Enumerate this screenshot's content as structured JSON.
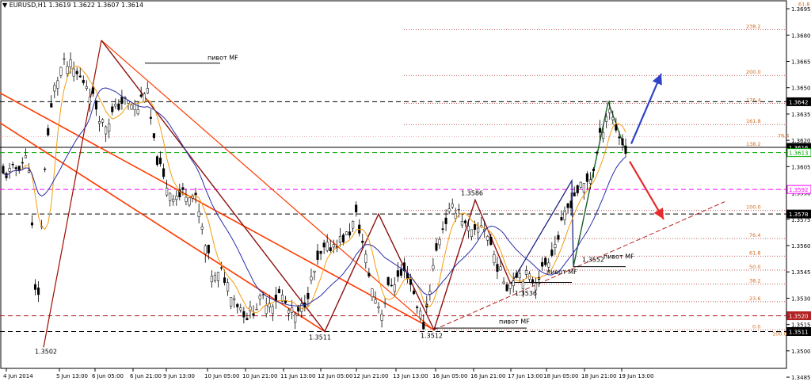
{
  "header": {
    "symbol_label": "EURUSD,H1",
    "ohlc_text": "1.3619 1.3622 1.3607 1.3614",
    "dropdown_glyph": "▼"
  },
  "colors": {
    "background": "#ffffff",
    "axis": "#000000",
    "candles": "#000000",
    "ma_fast": "#f39c12",
    "ma_slow": "#2b2fa8",
    "zigzag_dark": "#8b1010",
    "trend_orange": "#ff3b00",
    "fib_red": "#b22222",
    "fib_text": "#d2691e",
    "magenta": "#ff00ff",
    "green": "#00aa00",
    "arrow_blue": "#2f43c9",
    "arrow_red": "#e52b2b"
  },
  "chart_data": {
    "type": "candlestick",
    "symbol": "EURUSD",
    "timeframe": "H1",
    "ylim": [
      1.349,
      1.37
    ],
    "y_ticks": [
      "1.3695",
      "1.3680",
      "1.3665",
      "1.3650",
      "1.3635",
      "1.3620",
      "1.3605",
      "1.3590",
      "1.3575",
      "1.3560",
      "1.3545",
      "1.3530",
      "1.3515",
      "1.3500",
      "1.3485"
    ],
    "x_ticks": [
      "4 Jun 2014",
      "5 Jun 13:00",
      "6 Jun 05:00",
      "6 Jun 21:00",
      "9 Jun 13:00",
      "10 Jun 05:00",
      "10 Jun 21:00",
      "11 Jun 13:00",
      "12 Jun 05:00",
      "12 Jun 21:00",
      "13 Jun 13:00",
      "16 Jun 05:00",
      "16 Jun 21:00",
      "17 Jun 13:00",
      "18 Jun 05:00",
      "18 Jun 21:00",
      "19 Jun 13:00"
    ],
    "price_close_path": [
      1.36,
      1.3602,
      1.3606,
      1.3611,
      1.3515,
      1.361,
      1.3648,
      1.3663,
      1.3662,
      1.3656,
      1.3652,
      1.364,
      1.3628,
      1.3635,
      1.3642,
      1.3641,
      1.3638,
      1.3652,
      1.3615,
      1.3598,
      1.359,
      1.3588,
      1.3592,
      1.3585,
      1.356,
      1.354,
      1.3545,
      1.3535,
      1.3526,
      1.352,
      1.3525,
      1.353,
      1.3528,
      1.3533,
      1.3522,
      1.3519,
      1.353,
      1.3545,
      1.3556,
      1.356,
      1.3563,
      1.3566,
      1.3577,
      1.3555,
      1.3532,
      1.3523,
      1.3538,
      1.3542,
      1.3545,
      1.353,
      1.3514,
      1.3545,
      1.3568,
      1.3578,
      1.3583,
      1.357,
      1.3565,
      1.3574,
      1.356,
      1.3545,
      1.3537,
      1.3545,
      1.3543,
      1.354,
      1.3545,
      1.3555,
      1.3565,
      1.358,
      1.359,
      1.3594,
      1.36,
      1.3622,
      1.364,
      1.3625,
      1.3614
    ],
    "levels": [
      {
        "value": 1.3642,
        "label": "1.3642",
        "style": "dashed",
        "color": "#000000"
      },
      {
        "value": 1.3616,
        "label": "1.3616",
        "style": "solid",
        "color": "#000000"
      },
      {
        "value": 1.3613,
        "label": "1.3613",
        "style": "dashed",
        "color": "#00aa00"
      },
      {
        "value": 1.3592,
        "label": "1.3592",
        "style": "dashed",
        "color": "#ff00ff"
      },
      {
        "value": 1.3578,
        "label": "1.3578",
        "style": "dashed",
        "color": "#000000"
      },
      {
        "value": 1.352,
        "label": "1.3520",
        "style": "dashed",
        "color": "#b22222"
      },
      {
        "value": 1.3511,
        "label": "1.3511",
        "style": "dashed",
        "color": "#000000"
      }
    ],
    "fib_levels": [
      {
        "label": "0.0",
        "value": 1.3512
      },
      {
        "label": "23.6",
        "value": 1.3528
      },
      {
        "label": "38.2",
        "value": 1.3538
      },
      {
        "label": "50.0",
        "value": 1.3546
      },
      {
        "label": "61.8",
        "value": 1.3554
      },
      {
        "label": "76.4",
        "value": 1.3564
      },
      {
        "label": "100.0",
        "value": 1.358
      },
      {
        "label": "138.2",
        "value": 1.3616
      },
      {
        "label": "161.8",
        "value": 1.3629
      },
      {
        "label": "176.4",
        "value": 1.3641
      },
      {
        "label": "200.0",
        "value": 1.3657
      },
      {
        "label": "238.2",
        "value": 1.3683
      }
    ],
    "fib_extra_labels": [
      {
        "label": "61.8",
        "value": 1.3698
      },
      {
        "label": "76.4",
        "value": 1.3623
      },
      {
        "label": "100.0",
        "value": 1.351
      }
    ],
    "annotations": [
      {
        "text": "1.3502",
        "x": "5 Jun 13:00",
        "y": 1.3502
      },
      {
        "text": "1.3511",
        "x": "12 Jun 05:00",
        "y": 1.3511
      },
      {
        "text": "1.3512",
        "x": "16 Jun 05:00",
        "y": 1.3512
      },
      {
        "text": "1.3586",
        "x": "16 Jun 21:00",
        "y": 1.3586
      },
      {
        "text": "1.3536",
        "x": "17 Jun 13:00",
        "y": 1.3536
      },
      {
        "text": "1.3552",
        "x": "18 Jun 21:00",
        "y": 1.3552
      },
      {
        "text": "пивот MF",
        "x": "6 Jun 21:00",
        "y": 1.3666
      },
      {
        "text": "пивот MF",
        "x": "16 Jun 05:00",
        "y": 1.3512
      },
      {
        "text": "пивот MF",
        "x": "17 Jun 13:00",
        "y": 1.3542
      },
      {
        "text": "пивот MF",
        "x": "18 Jun 21:00",
        "y": 1.3552
      }
    ],
    "grid": false
  }
}
